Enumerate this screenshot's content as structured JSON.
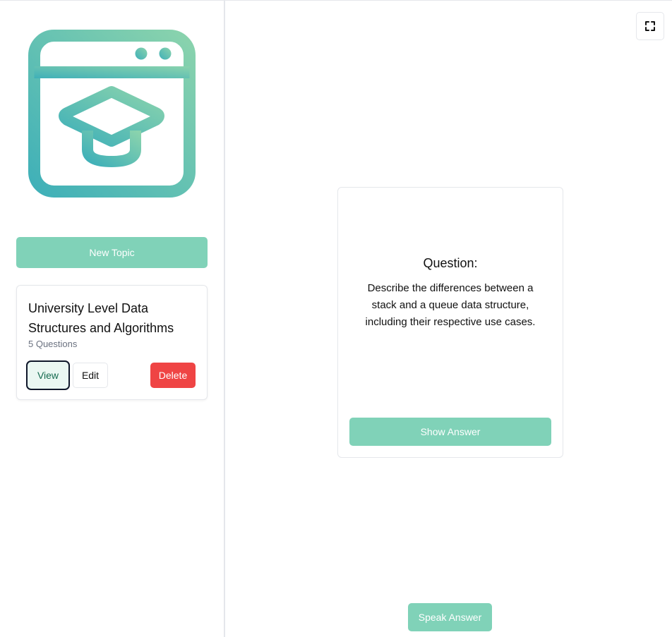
{
  "sidebar": {
    "logo_icon": "graduation-cap-browser-icon",
    "new_topic_label": "New Topic",
    "topics": [
      {
        "title": "University Level Data Structures and Algorithms",
        "count": "5 Questions",
        "view_label": "View",
        "edit_label": "Edit",
        "delete_label": "Delete"
      }
    ]
  },
  "main": {
    "expand_icon": "fullscreen-icon",
    "card": {
      "heading": "Question:",
      "question": "Describe the differences between a stack and a queue data structure, including their respective use cases.",
      "show_answer_label": "Show Answer"
    },
    "speak_answer_label": "Speak Answer"
  },
  "colors": {
    "accent": "#80d2b8",
    "danger": "#ef4444",
    "logo_gradient_start": "#3fb0b8",
    "logo_gradient_end": "#8ad3ad"
  }
}
